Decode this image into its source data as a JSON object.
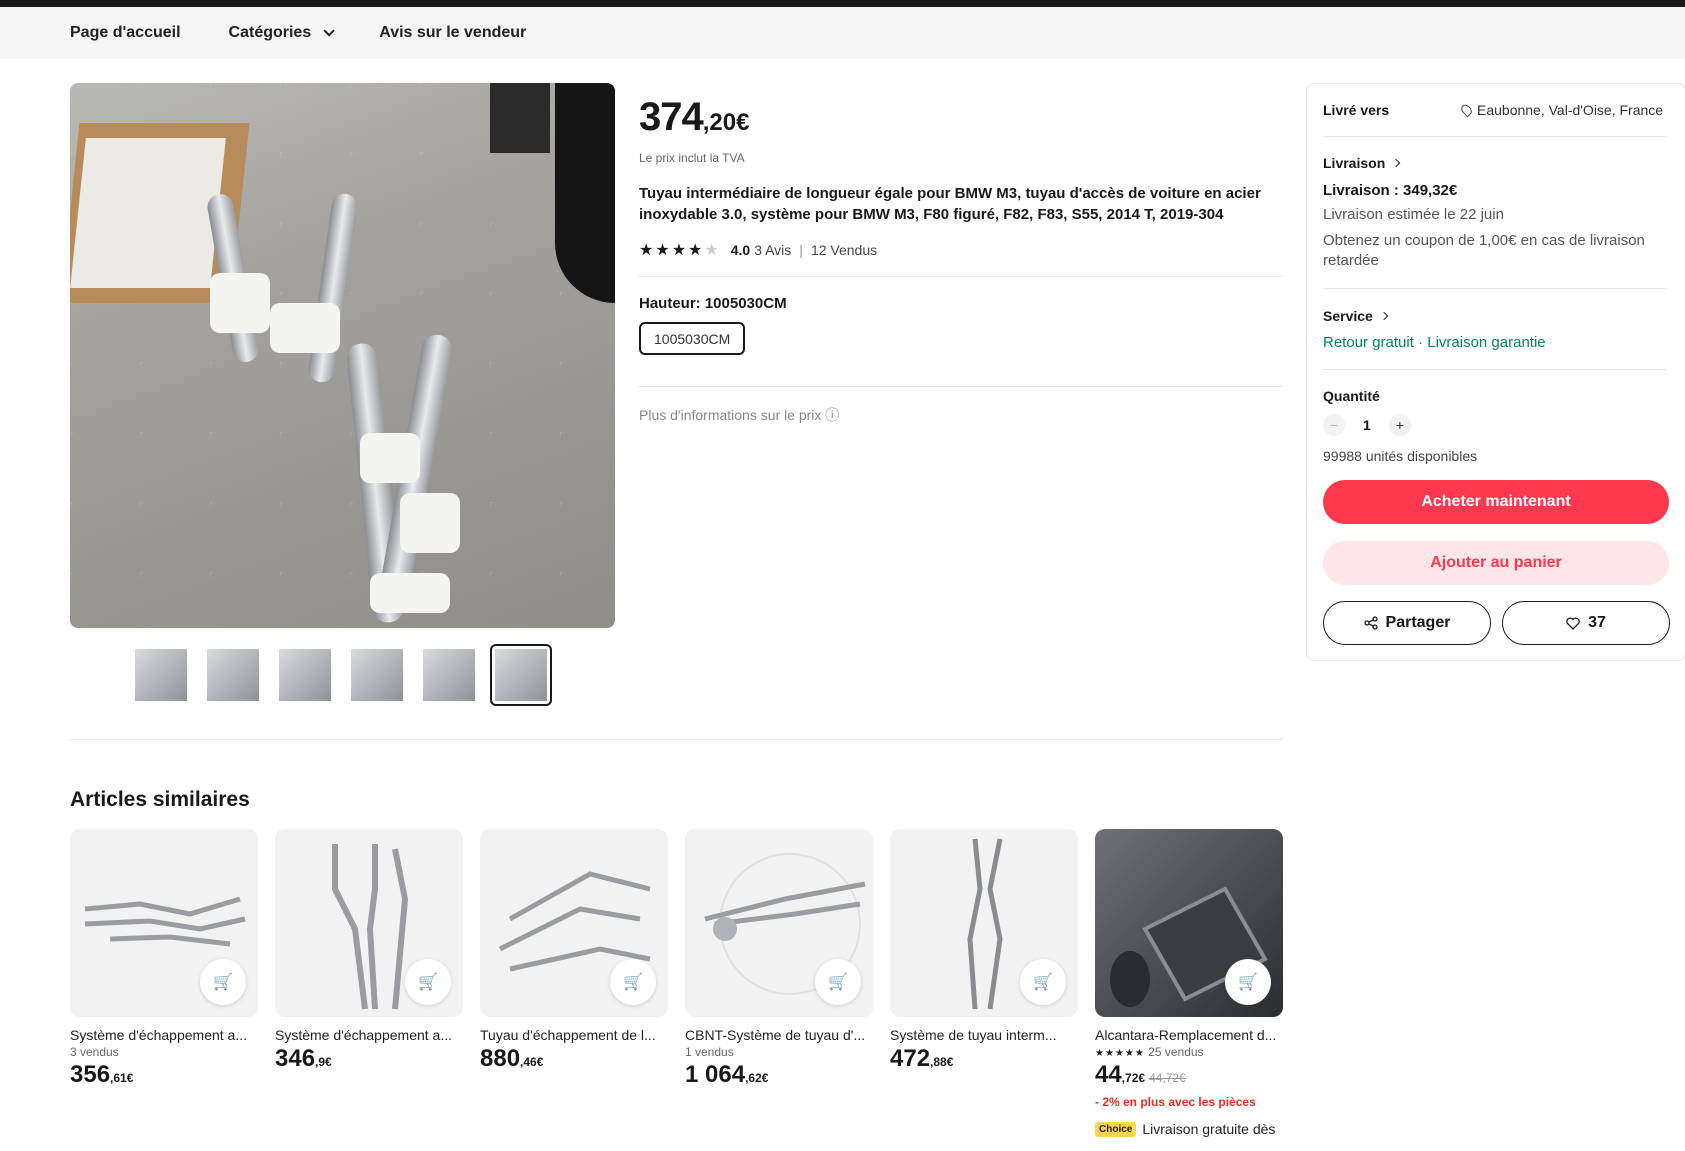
{
  "nav": {
    "home": "Page d'accueil",
    "categories": "Catégories",
    "reviews": "Avis sur le vendeur"
  },
  "product": {
    "price_int": "374",
    "price_dec": ",20€",
    "tax_note": "Le prix inclut la TVA",
    "title": "Tuyau intermédiaire de longueur égale pour BMW M3, tuyau d'accès de voiture en acier inoxydable 3.0, système pour BMW M3, F80 figuré, F82, F83, S55, 2014 T, 2019-304",
    "rating": "4.0",
    "reviews": "3 Avis",
    "sold": "12 Vendus",
    "variant_label": "Hauteur: 1005030CM",
    "variant_value": "1005030CM",
    "more_price": "Plus d'informations sur le prix ⓘ"
  },
  "panel": {
    "delivered_to_label": "Livré vers",
    "delivered_to": "Eaubonne, Val-d'Oise, France",
    "shipping_label": "Livraison",
    "shipping_cost": "Livraison : 349,32€",
    "estimate": "Livraison estimée le 22 juin",
    "coupon": "Obtenez un coupon de 1,00€ en cas de livraison retardée",
    "service_label": "Service",
    "service_1": "Retour gratuit",
    "service_dot": " · ",
    "service_2": "Livraison garantie",
    "qty_label": "Quantité",
    "qty_value": "1",
    "qty_minus": "−",
    "qty_plus": "+",
    "stock": "99988 unités disponibles",
    "buy": "Acheter maintenant",
    "cart": "Ajouter au panier",
    "share": "Partager",
    "fav_count": "37"
  },
  "similar": {
    "title": "Articles similaires",
    "items": [
      {
        "name": "Système d'échappement a...",
        "sold": "3 vendus",
        "price_int": "356",
        "price_dec": ",61€"
      },
      {
        "name": "Système d'échappement a...",
        "sold": "",
        "price_int": "346",
        "price_dec": ",9€"
      },
      {
        "name": "Tuyau d'échappement de l...",
        "sold": "",
        "price_int": "880",
        "price_dec": ",46€"
      },
      {
        "name": "CBNT-Système de tuyau d'...",
        "sold": "1 vendus",
        "price_int": "1 064",
        "price_dec": ",62€"
      },
      {
        "name": "Système de tuyau interm...",
        "sold": "",
        "price_int": "472",
        "price_dec": ",88€"
      },
      {
        "name": "Alcantara-Remplacement d...",
        "sold": "25 vendus",
        "price_int": "44",
        "price_dec": ",72€",
        "old_price": "44,72€",
        "promo": "- 2% en plus avec les pièces",
        "choice": "Choice",
        "choice_text": "Livraison gratuite dès"
      }
    ]
  },
  "colors": {
    "accent": "#fd384f",
    "accent_light": "#ffe7e9",
    "green": "#00875a"
  }
}
